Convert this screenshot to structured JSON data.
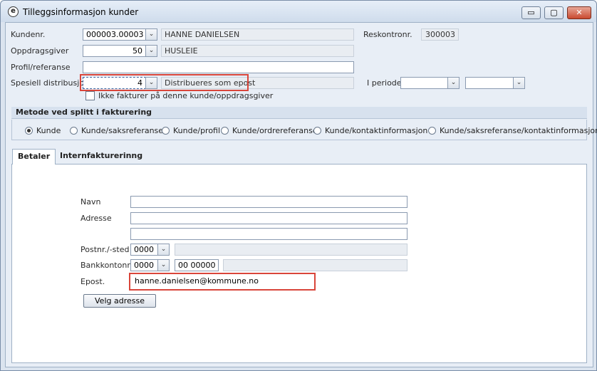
{
  "window": {
    "title": "Tilleggsinformasjon kunder",
    "icon": "e",
    "buttons": {
      "minimize": "▭",
      "maximize": "▢",
      "close": "✕"
    }
  },
  "form": {
    "kundenr": {
      "label": "Kundenr.",
      "value": "000003.00003",
      "name": "HANNE DANIELSEN"
    },
    "reskontro": {
      "label": "Reskontronr.",
      "value": "300003"
    },
    "oppdragsgiver": {
      "label": "Oppdragsgiver",
      "value": "50",
      "name": "HUSLEIE"
    },
    "profil": {
      "label": "Profil/referanse",
      "value": ""
    },
    "distribusjon": {
      "label": "Spesiell distribusjon",
      "value": "4",
      "text": "Distribueres som epost"
    },
    "periode": {
      "label": "I periode",
      "from": "",
      "to": ""
    },
    "no_invoice": {
      "label": "Ikke fakturer på denne kunde/oppdragsgiver",
      "checked": false
    }
  },
  "split": {
    "heading": "Metode ved splitt i fakturering",
    "options": [
      {
        "label": "Kunde",
        "selected": true
      },
      {
        "label": "Kunde/saksreferanse",
        "selected": false
      },
      {
        "label": "Kunde/profil",
        "selected": false
      },
      {
        "label": "Kunde/ordrereferanse",
        "selected": false
      },
      {
        "label": "Kunde/kontaktinformasjon",
        "selected": false
      },
      {
        "label": "Kunde/saksreferanse/kontaktinformasjon",
        "selected": false
      }
    ]
  },
  "tabs": [
    {
      "label": "Betaler",
      "active": true
    },
    {
      "label": "Internfakturerinng",
      "active": false
    }
  ],
  "payer": {
    "navn": {
      "label": "Navn",
      "value": ""
    },
    "adresse": {
      "label": "Adresse",
      "line1": "",
      "line2": ""
    },
    "postnr": {
      "label": "Postnr./-sted",
      "code": "0000",
      "place": ""
    },
    "bankkonto": {
      "label": "Bankkontonr.",
      "code": "0000",
      "number": "00 00000",
      "rest": ""
    },
    "epost": {
      "label": "Epost.",
      "value": "hanne.danielsen@kommune.no"
    },
    "velg_button": "Velg adresse"
  },
  "colors": {
    "highlight": "#d9453a",
    "window_bg": "#dbe4ef",
    "panel_bg": "#ffffff"
  }
}
